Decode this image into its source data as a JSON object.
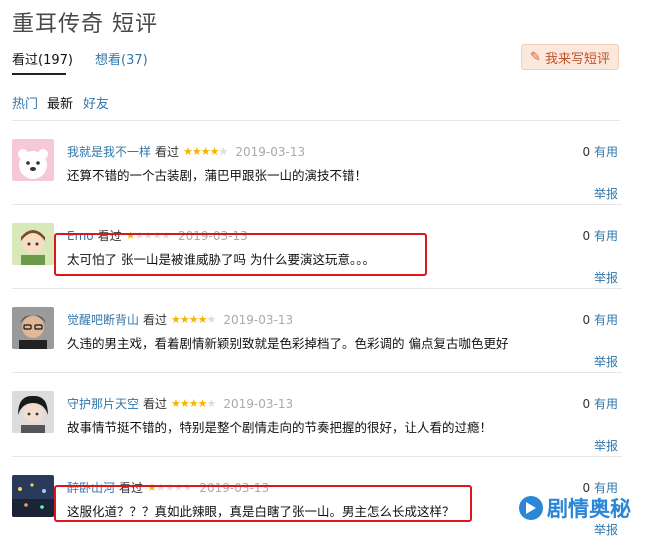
{
  "page": {
    "title": "重耳传奇 短评"
  },
  "tabs": {
    "seen_label": "看过(197)",
    "want_label": "想看(37)"
  },
  "write_button": {
    "label": "我来写短评",
    "icon": "pencil-icon"
  },
  "sort": {
    "hot": "热门",
    "new": "最新",
    "friends": "好友"
  },
  "vote_suffix": "有用",
  "report_label": "举报",
  "comments": [
    {
      "author": "我就是我不一样",
      "status": "看过",
      "rating": 4,
      "date": "2019-03-13",
      "votes": "0",
      "text": "还算不错的一个古装剧，蒲巴甲跟张一山的演技不错！"
    },
    {
      "author": "Emo",
      "status": "看过",
      "rating": 1,
      "date": "2019-03-13",
      "votes": "0",
      "text": "太可怕了 张一山是被谁威胁了吗 为什么要演这玩意。。。"
    },
    {
      "author": "觉醒吧断背山",
      "status": "看过",
      "rating": 4,
      "date": "2019-03-13",
      "votes": "0",
      "text": "久违的男主戏，看着剧情新颖别致就是色彩掉档了。色彩调的 偏点复古咖色更好"
    },
    {
      "author": "守护那片天空",
      "status": "看过",
      "rating": 4,
      "date": "2019-03-13",
      "votes": "0",
      "text": "故事情节挺不错的，特别是整个剧情走向的节奏把握的很好，让人看的过瘾！"
    },
    {
      "author": "醉卧山河",
      "status": "看过",
      "rating": 1,
      "date": "2019-03-13",
      "votes": "0",
      "text": "这服化道？？？真如此辣眼，真是白瞎了张一山。男主怎么长成这样？"
    }
  ],
  "watermark": {
    "text": "剧情奥秘"
  }
}
